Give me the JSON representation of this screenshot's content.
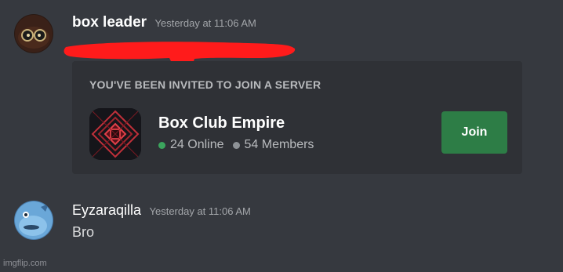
{
  "messages": [
    {
      "author": "box leader",
      "timestamp": "Yesterday at 11:06 AM",
      "avatar_icon": "cartoon-face-avatar-icon",
      "redaction_color": "#ff1b1b",
      "invite": {
        "heading": "YOU'VE BEEN INVITED TO JOIN A SERVER",
        "server_name": "Box Club Empire",
        "server_icon": "server-emblem-icon",
        "online": "24 Online",
        "members": "54 Members",
        "join_label": "Join"
      }
    },
    {
      "author": "Eyzaraqilla",
      "timestamp": "Yesterday at 11:06 AM",
      "avatar_icon": "fish-avatar-icon",
      "content": "Bro"
    }
  ],
  "watermark": "imgflip.com",
  "colors": {
    "background": "#36393f",
    "embed_background": "#2f3136",
    "join_button": "#2d7d46",
    "online_dot": "#3ba55d",
    "members_dot": "#8e9297"
  }
}
